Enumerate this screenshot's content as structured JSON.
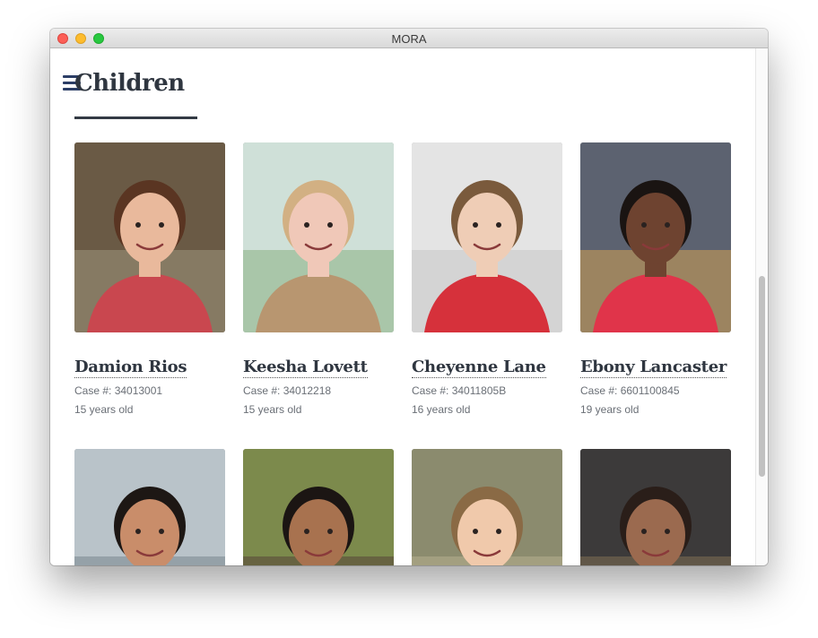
{
  "window": {
    "title": "MORA"
  },
  "page": {
    "title": "Children"
  },
  "children": [
    {
      "name": "Damion Rios",
      "case": "Case #: 34013001",
      "age": "15 years old",
      "shirt": "#c9474f",
      "bg": "#6a5a45",
      "bg2": "#9a8f78",
      "hair": "#5a3522",
      "skin": "#e9b99c"
    },
    {
      "name": "Keesha Lovett",
      "case": "Case #: 34012218",
      "age": "15 years old",
      "shirt": "#b89670",
      "bg": "#cfe0d8",
      "bg2": "#8fb48a",
      "hair": "#d2b083",
      "skin": "#f0c8b8"
    },
    {
      "name": "Cheyenne Lane",
      "case": "Case #: 34011805B",
      "age": "16 years old",
      "shirt": "#d6313b",
      "bg": "#e4e4e4",
      "bg2": "#c9c9c9",
      "hair": "#7a5a3c",
      "skin": "#efcdb6"
    },
    {
      "name": "Ebony Lancaster",
      "case": "Case #: 6601100845",
      "age": "19 years old",
      "shirt": "#e0344a",
      "bg": "#5c6270",
      "bg2": "#c79b55",
      "hair": "#1a1412",
      "skin": "#6e4330"
    },
    {
      "name": "",
      "case": "",
      "age": "",
      "shirt": "#e8e8e8",
      "bg": "#b9c3c9",
      "bg2": "#7d8a93",
      "hair": "#1d1714",
      "skin": "#c98d6a"
    },
    {
      "name": "",
      "case": "",
      "age": "",
      "shirt": "#c23a3a",
      "bg": "#7c8a4c",
      "bg2": "#5a4a3a",
      "hair": "#1b1513",
      "skin": "#a8724f"
    },
    {
      "name": "",
      "case": "",
      "age": "",
      "shirt": "#3b5fb5",
      "bg": "#8b8b6e",
      "bg2": "#b4ad8c",
      "hair": "#8a6a45",
      "skin": "#f0c9ab"
    },
    {
      "name": "",
      "case": "",
      "age": "",
      "shirt": "#d8d8d8",
      "bg": "#3c3a3a",
      "bg2": "#7a6a52",
      "hair": "#2a1e19",
      "skin": "#9b6a4f"
    }
  ],
  "colors": {
    "accent": "#2f3640",
    "menu": "#2c3e66",
    "meta_text": "#6a6f76"
  }
}
